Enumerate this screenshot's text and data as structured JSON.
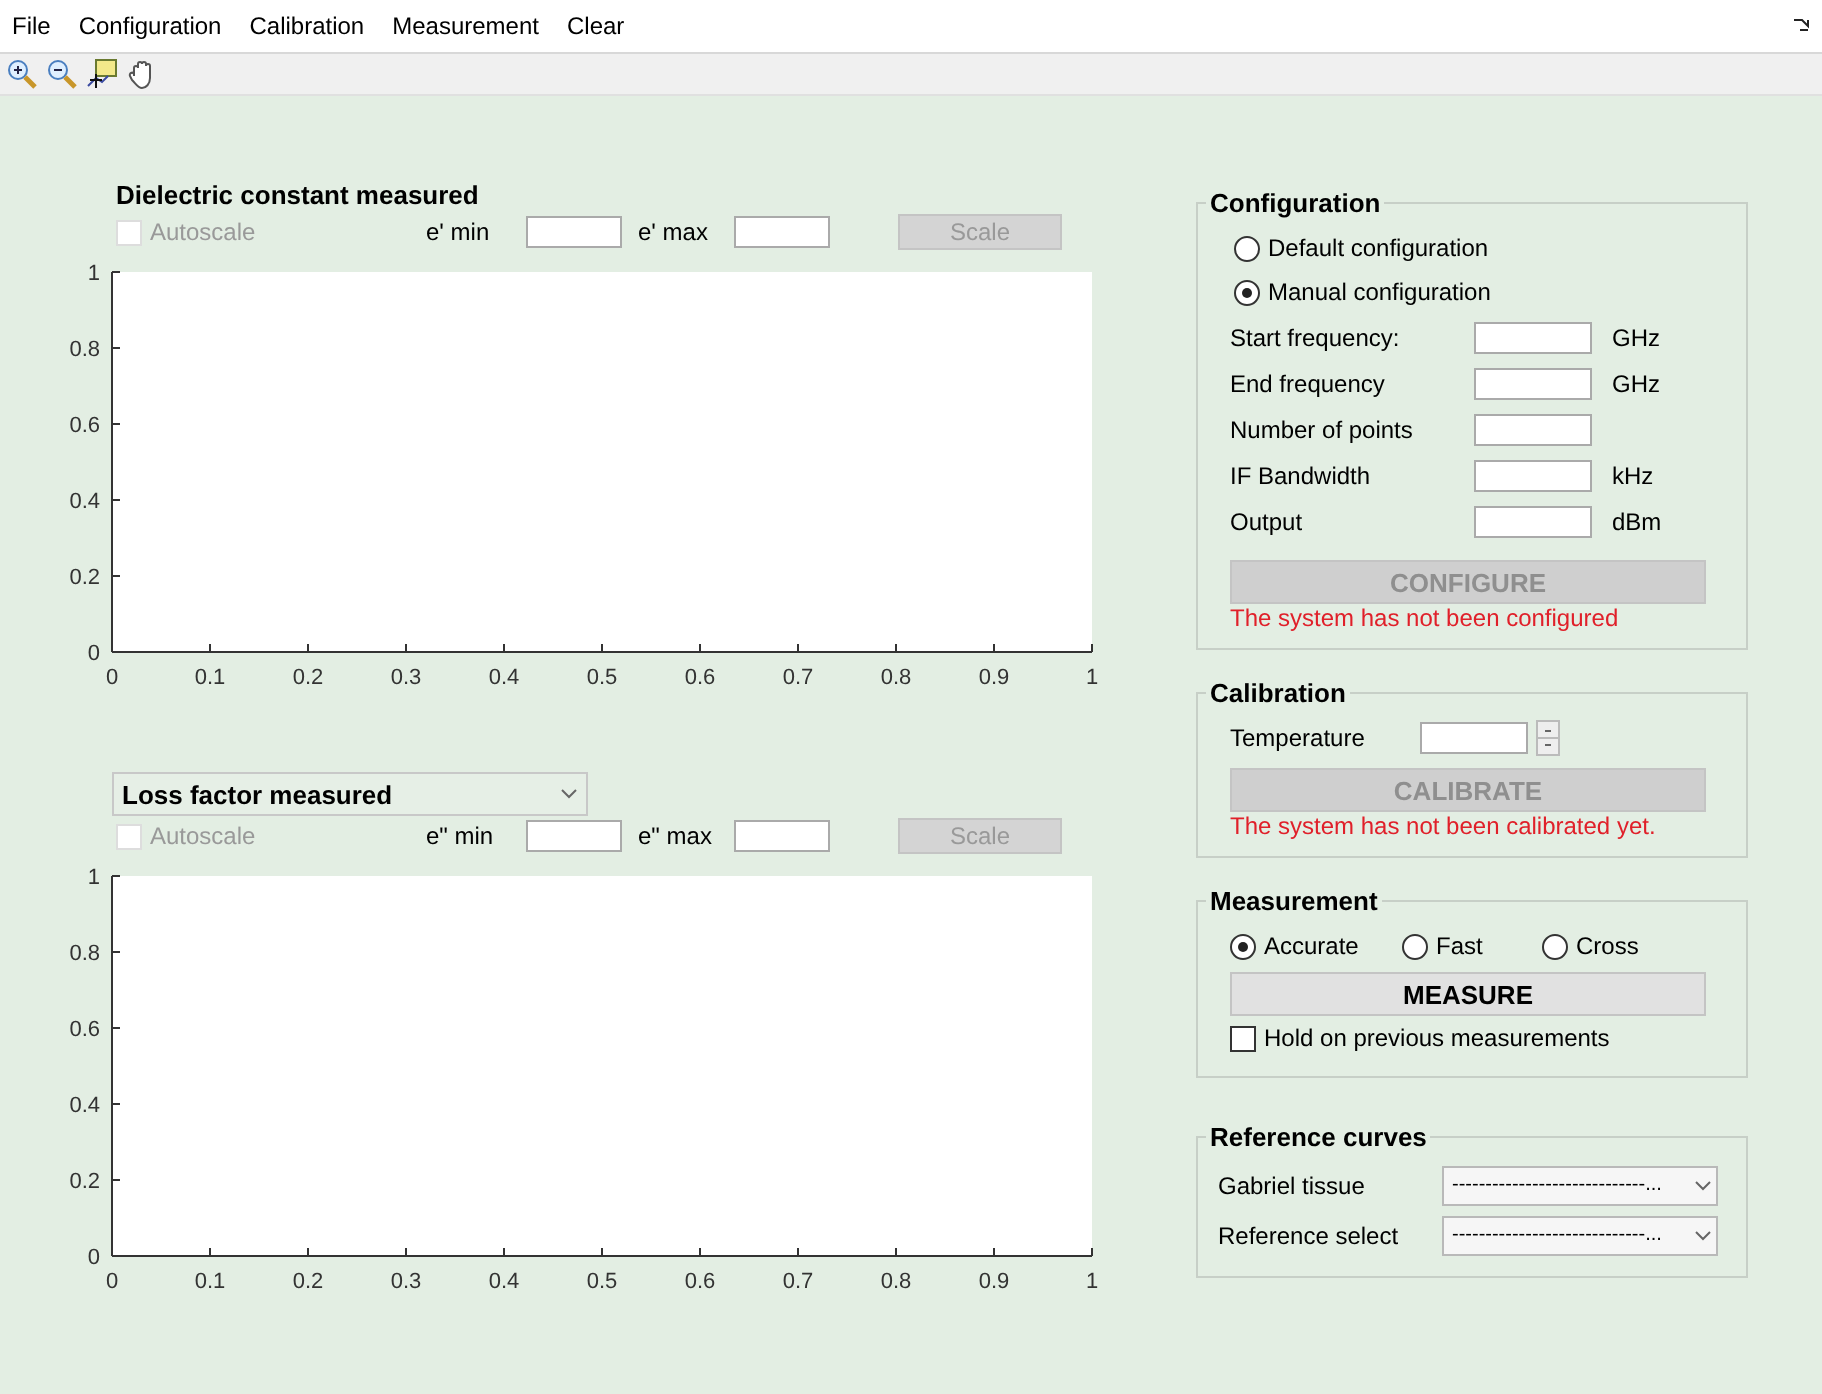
{
  "menu": [
    "File",
    "Configuration",
    "Calibration",
    "Measurement",
    "Clear"
  ],
  "plots": [
    {
      "title": {
        "kind": "label",
        "text": "Dielectric constant measured"
      },
      "autoscale": {
        "label": "Autoscale",
        "checked": false,
        "disabled": true
      },
      "min_label": "e' min",
      "max_label": "e' max",
      "scale_button": {
        "label": "Scale",
        "disabled": true
      },
      "chart_data": {
        "type": "line",
        "xlim": [
          0,
          1
        ],
        "ylim": [
          0,
          1
        ],
        "xticks": [
          0,
          0.1,
          0.2,
          0.3,
          0.4,
          0.5,
          0.6,
          0.7,
          0.8,
          0.9,
          1
        ],
        "yticks": [
          0,
          0.2,
          0.4,
          0.6,
          0.8,
          1
        ]
      }
    },
    {
      "title": {
        "kind": "dropdown",
        "text": "Loss factor measured"
      },
      "autoscale": {
        "label": "Autoscale",
        "checked": false,
        "disabled": true
      },
      "min_label": "e\" min",
      "max_label": "e\" max",
      "scale_button": {
        "label": "Scale",
        "disabled": true
      },
      "chart_data": {
        "type": "line",
        "xlim": [
          0,
          1
        ],
        "ylim": [
          0,
          1
        ],
        "xticks": [
          0,
          0.1,
          0.2,
          0.3,
          0.4,
          0.5,
          0.6,
          0.7,
          0.8,
          0.9,
          1
        ],
        "yticks": [
          0,
          0.2,
          0.4,
          0.6,
          0.8,
          1
        ]
      }
    }
  ],
  "configuration": {
    "title": "Configuration",
    "options": [
      {
        "label": "Default configuration",
        "selected": false
      },
      {
        "label": "Manual configuration",
        "selected": true
      }
    ],
    "fields": [
      {
        "label": "Start frequency:",
        "unit": "GHz"
      },
      {
        "label": "End frequency",
        "unit": "GHz"
      },
      {
        "label": "Number of points"
      },
      {
        "label": "IF Bandwidth",
        "unit": "kHz"
      },
      {
        "label": "Output",
        "unit": "dBm"
      }
    ],
    "button": {
      "label": "CONFIGURE",
      "disabled": true
    },
    "status": "The system has not been configured"
  },
  "calibration": {
    "title": "Calibration",
    "field": {
      "label": "Temperature"
    },
    "button": {
      "label": "CALIBRATE",
      "disabled": true
    },
    "status": "The system has not been calibrated yet."
  },
  "measurement": {
    "title": "Measurement",
    "modes": [
      {
        "label": "Accurate",
        "selected": true
      },
      {
        "label": "Fast",
        "selected": false
      },
      {
        "label": "Cross",
        "selected": false
      }
    ],
    "button": {
      "label": "MEASURE",
      "disabled": false
    },
    "hold": {
      "label": "Hold on previous measurements",
      "checked": false
    }
  },
  "reference_curves": {
    "title": "Reference curves",
    "selects": [
      {
        "label": "Gabriel tissue",
        "value": "-----------------------------..."
      },
      {
        "label": "Reference select",
        "value": "-----------------------------..."
      }
    ]
  }
}
